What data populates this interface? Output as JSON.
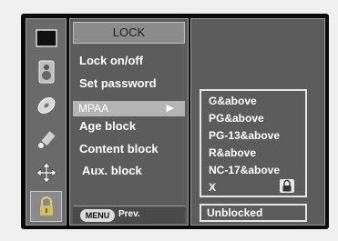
{
  "menu": {
    "title": "LOCK",
    "items": [
      "Lock on/off",
      "Set password"
    ],
    "selected": "MPAA",
    "selected_arrow": "▶",
    "items_after": [
      "Age block",
      "Content block",
      "Aux. block"
    ]
  },
  "footer": {
    "menu_button": "MENU",
    "prev_label": "Prev."
  },
  "submenu": {
    "options": [
      "G&above",
      "PG&above",
      "PG-13&above",
      "R&above",
      "NC-17&above",
      "X"
    ],
    "locked_option_icon": "padlock-icon"
  },
  "status": "Unblocked",
  "icons": [
    "picture-icon",
    "speaker-icon",
    "disc-icon",
    "satellite-icon",
    "move-arrows-icon",
    "padlock-icon"
  ],
  "colors": {
    "panel": "#5c5c5c",
    "highlight": "#b4b4b4",
    "frame": "#0b0b0b",
    "text": "#ffffff"
  }
}
